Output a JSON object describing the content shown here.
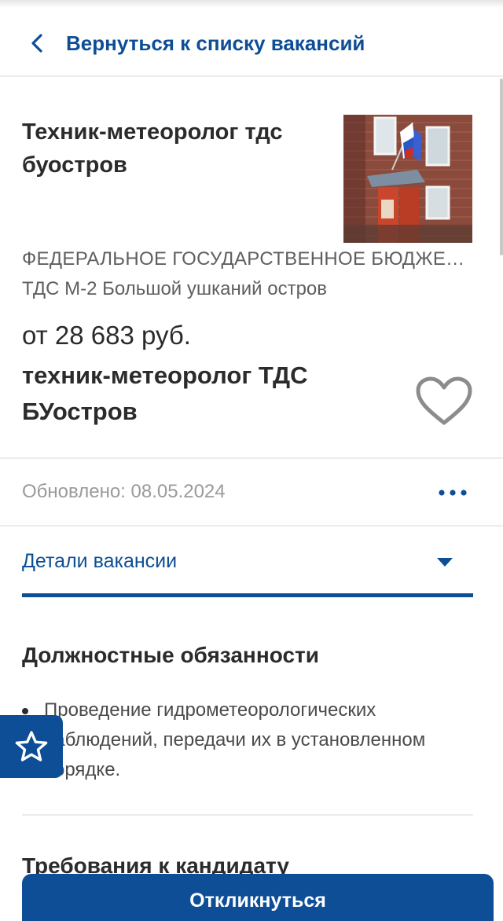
{
  "nav": {
    "back_label": "Вернуться к списку вакансий"
  },
  "vacancy": {
    "title": "Техник-метеоролог тдс буостров",
    "organization": "ФЕДЕРАЛЬНОЕ ГОСУДАРСТВЕННОЕ БЮДЖЕТНОЕ УЧРЕЖДЕНИЕ",
    "branch": "ТДС М-2 Большой ушканий остров",
    "salary": "от 28 683 руб.",
    "position": "техник-метеоролог ТДС БУостров",
    "updated": "Обновлено: 08.05.2024"
  },
  "tabs": {
    "details_label": "Детали вакансии"
  },
  "sections": {
    "duties_title": "Должностные обязанности",
    "duties": [
      "Проведение гидрометеорологических наблюдений, передачи их в установленном порядке."
    ],
    "requirements_title": "Требования к кандидату"
  },
  "actions": {
    "apply_label": "Откликнуться"
  },
  "icons": {
    "back": "chevron-left-icon",
    "favorite": "heart-icon",
    "more": "more-dots-icon",
    "expand": "caret-down-icon",
    "favorites_float": "star-icon"
  },
  "colors": {
    "accent": "#0d4e96",
    "text": "#2b2b2b",
    "muted": "#9a9a9a"
  }
}
